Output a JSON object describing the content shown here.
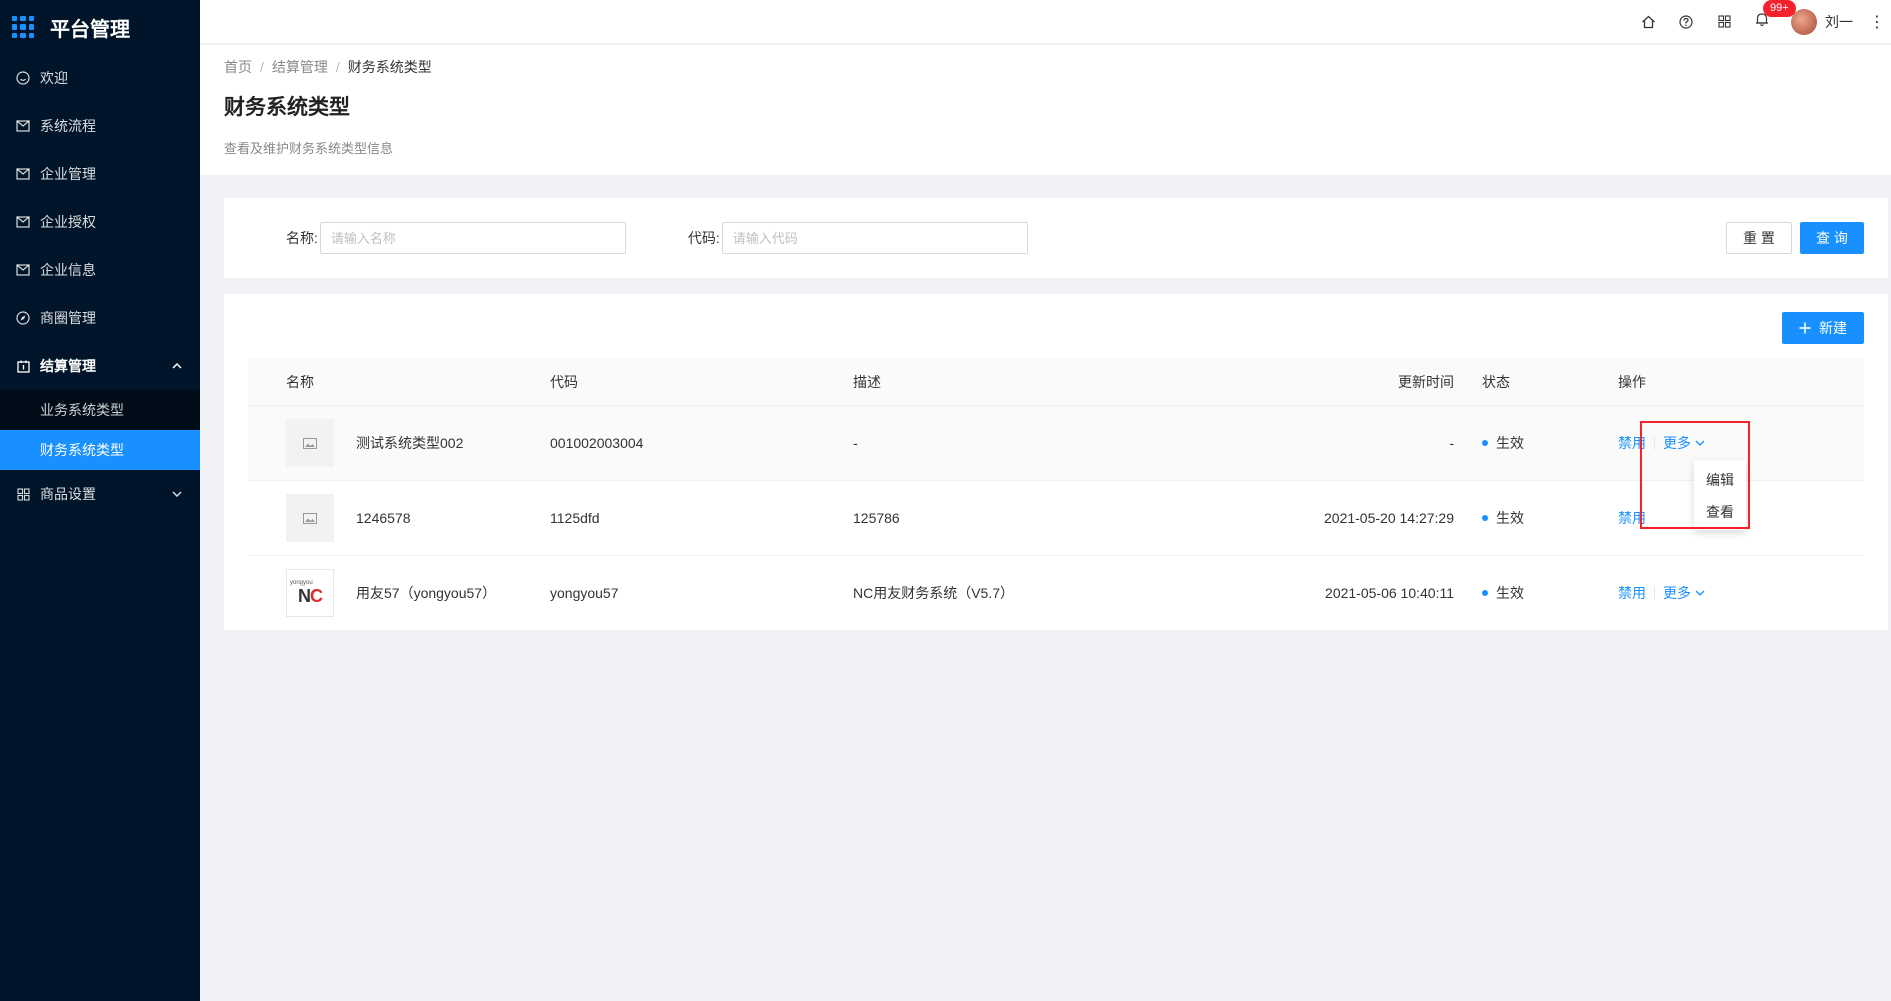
{
  "app": {
    "title": "平台管理"
  },
  "sidebar": {
    "items": [
      {
        "label": "欢迎",
        "icon": "smile-icon"
      },
      {
        "label": "系统流程",
        "icon": "mail-icon"
      },
      {
        "label": "企业管理",
        "icon": "mail-icon"
      },
      {
        "label": "企业授权",
        "icon": "mail-icon"
      },
      {
        "label": "企业信息",
        "icon": "mail-icon"
      },
      {
        "label": "商圈管理",
        "icon": "compass-icon"
      },
      {
        "label": "结算管理",
        "icon": "calendar-icon",
        "open": true
      },
      {
        "label": "商品设置",
        "icon": "appstore-icon"
      }
    ],
    "sub_items": [
      {
        "label": "业务系统类型"
      },
      {
        "label": "财务系统类型",
        "active": true
      }
    ]
  },
  "header": {
    "icons": [
      "home-icon",
      "question-icon",
      "apps-icon",
      "bell-icon"
    ],
    "notification_badge": "99+",
    "user_name": "刘一"
  },
  "breadcrumb": [
    "首页",
    "结算管理",
    "财务系统类型"
  ],
  "page": {
    "title": "财务系统类型",
    "description": "查看及维护财务系统类型信息"
  },
  "filter": {
    "name_label": "名称:",
    "name_placeholder": "请输入名称",
    "code_label": "代码:",
    "code_placeholder": "请输入代码",
    "reset_label": "重 置",
    "query_label": "查 询"
  },
  "table": {
    "new_label": "新建",
    "columns": [
      "名称",
      "代码",
      "描述",
      "更新时间",
      "状态",
      "操作"
    ],
    "rows": [
      {
        "name": "测试系统类型002",
        "code": "001002003004",
        "desc": "-",
        "time": "-",
        "status": "生效",
        "op1": "禁用",
        "op2": "更多"
      },
      {
        "name": "1246578",
        "code": "1125dfd",
        "desc": "125786",
        "time": "2021-05-20 14:27:29",
        "status": "生效",
        "op1": "禁用",
        "op2": "更多"
      },
      {
        "name": "用友57（yongyou57）",
        "code": "yongyou57",
        "desc": "NC用友财务系统（V5.7）",
        "time": "2021-05-06 10:40:11",
        "status": "生效",
        "op1": "禁用",
        "op2": "更多",
        "logo_small": "yongyou",
        "logo_text": "NC"
      }
    ]
  },
  "dropdown": {
    "items": [
      "编辑",
      "查看"
    ]
  },
  "colors": {
    "primary": "#1890ff",
    "sidebar_bg": "#001529",
    "highlight": "#f5222d",
    "badge": "#f5222d"
  }
}
